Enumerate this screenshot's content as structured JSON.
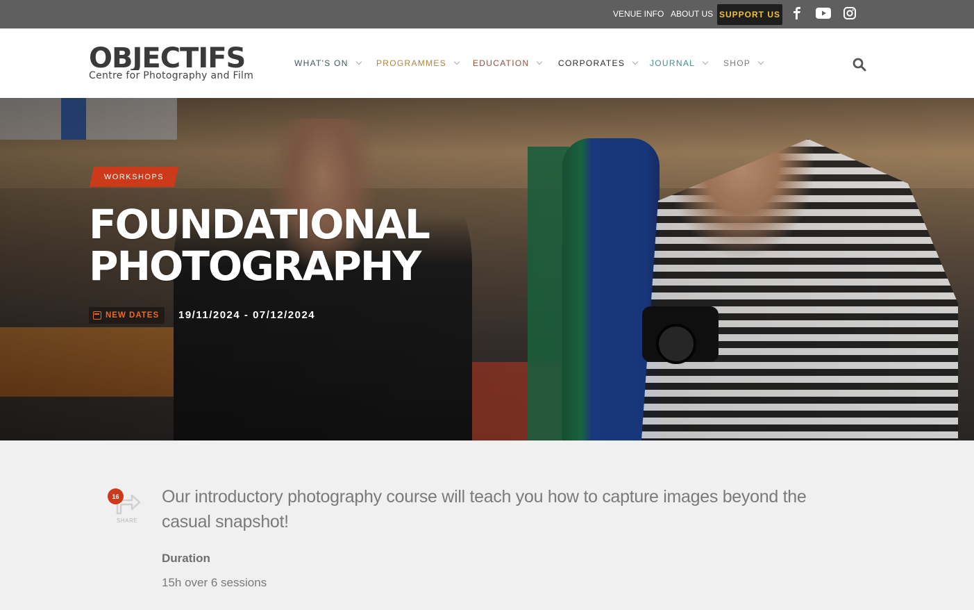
{
  "topbar": {
    "venue_info": "VENUE INFO",
    "about_us": "ABOUT US",
    "support_us": "SUPPORT US",
    "social": [
      "facebook-icon",
      "youtube-icon",
      "instagram-icon"
    ]
  },
  "header": {
    "logo_word": "OBJECTIFS",
    "logo_tagline": "Centre for Photography and Film",
    "nav": [
      {
        "label": "WHAT'S ON",
        "color": "#3f5a5c"
      },
      {
        "label": "PROGRAMMES",
        "color": "#b0843a"
      },
      {
        "label": "EDUCATION",
        "color": "#9b4c34"
      },
      {
        "label": "CORPORATES",
        "color": "#2a2a2a"
      },
      {
        "label": "JOURNAL",
        "color": "#3a8f94"
      },
      {
        "label": "SHOP",
        "color": "#7a7a7a"
      }
    ]
  },
  "hero": {
    "tag": "WORKSHOPS",
    "title_line1": "FOUNDATIONAL",
    "title_line2": "PHOTOGRAPHY",
    "badge": "NEW DATES",
    "dates": "19/11/2024 - 07/12/2024"
  },
  "content": {
    "share_count": "16",
    "share_label": "SHARE",
    "intro": "Our introductory photography course will teach you how to capture images beyond the casual snapshot!",
    "duration_label": "Duration",
    "duration_value": "15h over 6 sessions"
  },
  "colors": {
    "accent_red": "#cc3a1a",
    "support_yellow": "#f2c230",
    "topbar_bg": "#5f5f5f"
  }
}
